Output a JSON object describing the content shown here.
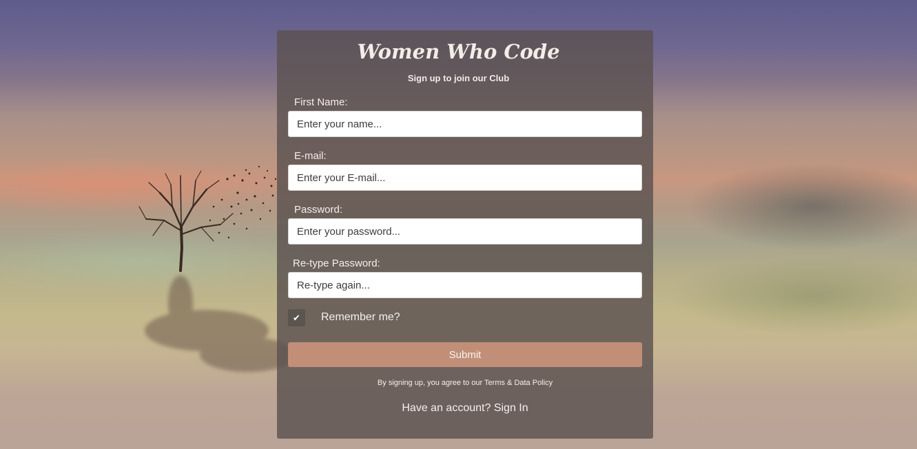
{
  "form": {
    "title": "Women Who Code",
    "subtitle": "Sign up to join our Club",
    "fields": [
      {
        "label": "First Name:",
        "placeholder": "Enter your name...",
        "value": ""
      },
      {
        "label": "E-mail:",
        "placeholder": "Enter your E-mail...",
        "value": ""
      },
      {
        "label": "Password:",
        "placeholder": "Enter your password...",
        "value": ""
      },
      {
        "label": "Re-type Password:",
        "placeholder": "Re-type again...",
        "value": ""
      }
    ],
    "remember_label": "Remember me?",
    "remember_checked": true,
    "check_glyph": "✔",
    "submit_label": "Submit",
    "terms_text": "By signing up, you agree to our Terms & Data Policy",
    "have_account_text": "Have an account?",
    "signin_label": "Sign In"
  },
  "colors": {
    "card_bg": "#5c5250",
    "submit_bg": "#c18f78",
    "text": "#f4efec",
    "checkbox_bg": "#5a554f"
  },
  "icons": {
    "background": "tree-with-birds-landscape"
  }
}
